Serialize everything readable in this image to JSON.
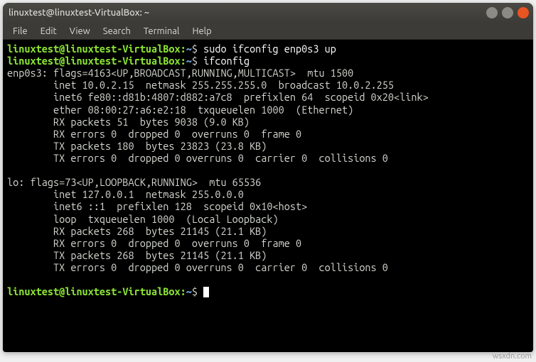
{
  "window": {
    "title": "linuxtest@linuxtest-VirtualBox: ~"
  },
  "menubar": {
    "file": "File",
    "edit": "Edit",
    "view": "View",
    "search": "Search",
    "terminal": "Terminal",
    "help": "Help"
  },
  "prompt": {
    "user_host": "linuxtest@linuxtest-VirtualBox",
    "colon": ":",
    "path": "~",
    "symbol": "$"
  },
  "commands": {
    "cmd1": " sudo ifconfig enp0s3 up",
    "cmd2": " ifconfig",
    "cmd3": " "
  },
  "output": {
    "l1": "enp0s3: flags=4163<UP,BROADCAST,RUNNING,MULTICAST>  mtu 1500",
    "l2": "        inet 10.0.2.15  netmask 255.255.255.0  broadcast 10.0.2.255",
    "l3": "        inet6 fe80::d81b:4807:d882:a7c8  prefixlen 64  scopeid 0x20<link>",
    "l4": "        ether 08:00:27:a6:e2:18  txqueuelen 1000  (Ethernet)",
    "l5": "        RX packets 51  bytes 9038 (9.0 KB)",
    "l6": "        RX errors 0  dropped 0  overruns 0  frame 0",
    "l7": "        TX packets 180  bytes 23823 (23.8 KB)",
    "l8": "        TX errors 0  dropped 0 overruns 0  carrier 0  collisions 0",
    "l9": "",
    "l10": "lo: flags=73<UP,LOOPBACK,RUNNING>  mtu 65536",
    "l11": "        inet 127.0.0.1  netmask 255.0.0.0",
    "l12": "        inet6 ::1  prefixlen 128  scopeid 0x10<host>",
    "l13": "        loop  txqueuelen 1000  (Local Loopback)",
    "l14": "        RX packets 268  bytes 21145 (21.1 KB)",
    "l15": "        RX errors 0  dropped 0  overruns 0  frame 0",
    "l16": "        TX packets 268  bytes 21145 (21.1 KB)",
    "l17": "        TX errors 0  dropped 0 overruns 0  carrier 0  collisions 0",
    "l18": ""
  },
  "watermark": "wsxdn.com"
}
